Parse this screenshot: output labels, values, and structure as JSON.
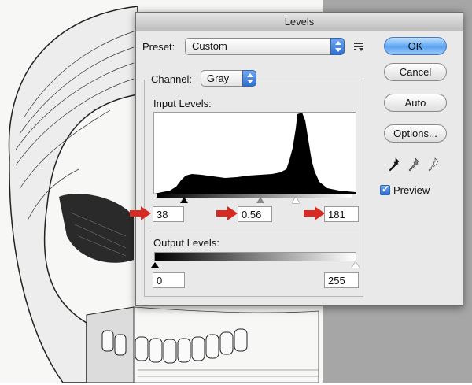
{
  "dialog": {
    "title": "Levels"
  },
  "preset": {
    "label": "Preset:",
    "value": "Custom",
    "menu_icon": "preset-options-icon"
  },
  "channel": {
    "label": "Channel:",
    "value": "Gray"
  },
  "input_levels": {
    "label": "Input Levels:",
    "shadows": "38",
    "midtones": "0.56",
    "highlights": "181"
  },
  "output_levels": {
    "label": "Output Levels:",
    "shadows": "0",
    "highlights": "255"
  },
  "buttons": {
    "ok": "OK",
    "cancel": "Cancel",
    "auto": "Auto",
    "options": "Options..."
  },
  "preview": {
    "label": "Preview",
    "checked": true
  },
  "eyedroppers": [
    "black-point-eyedropper-icon",
    "gray-point-eyedropper-icon",
    "white-point-eyedropper-icon"
  ],
  "colors": {
    "accent": "#3a7ee0",
    "arrow": "#d52b22"
  }
}
